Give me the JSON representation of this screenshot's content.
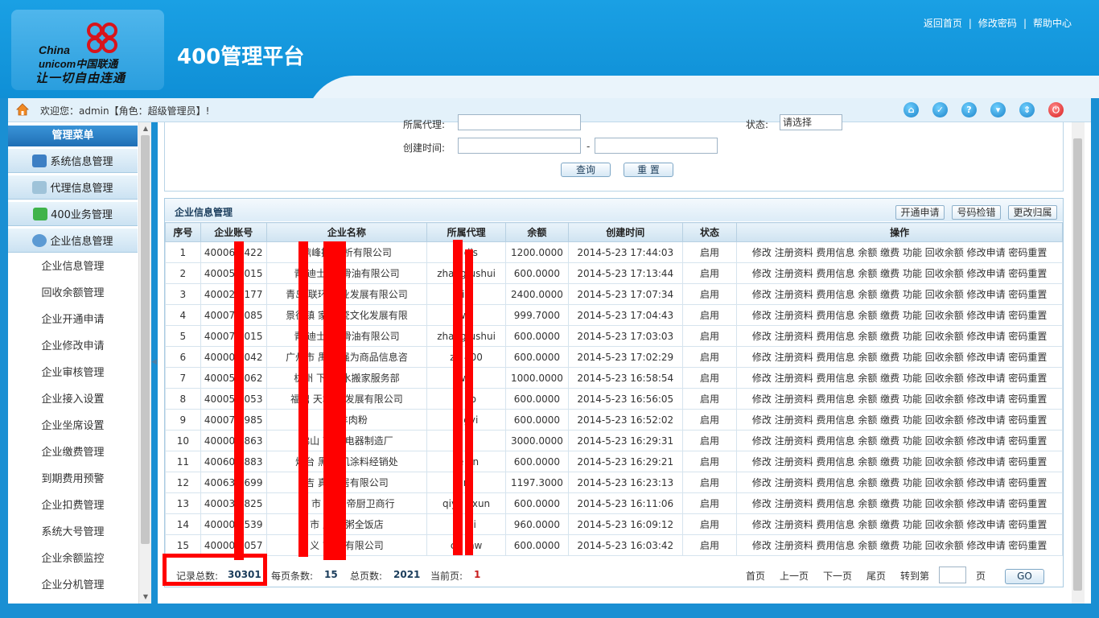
{
  "header": {
    "title": "400管理平台",
    "logo": {
      "china": "China",
      "unicom": "unicom中国联通",
      "slogan": "让一切自由连通"
    },
    "links": [
      "返回首页",
      "修改密码",
      "帮助中心"
    ]
  },
  "infobar": {
    "welcome": "欢迎您：admin【角色：超级管理员】!"
  },
  "toolbar_icons": [
    "home-icon",
    "check-icon",
    "help-icon",
    "shirt-icon",
    "updown-icon",
    "power-icon"
  ],
  "sidebar": {
    "title": "管理菜单",
    "groups": [
      "系统信息管理",
      "代理信息管理",
      "400业务管理",
      "企业信息管理"
    ],
    "items": [
      "企业信息管理",
      "回收余额管理",
      "企业开通申请",
      "企业修改申请",
      "企业审核管理",
      "企业接入设置",
      "企业坐席设置",
      "企业缴费管理",
      "到期费用预警",
      "企业扣费管理",
      "系统大号管理",
      "企业余额监控",
      "企业分机管理"
    ]
  },
  "search": {
    "agent_label": "所属代理:",
    "status_label": "状态:",
    "status_value": "请选择",
    "created_label": "创建时间:",
    "dash": "-",
    "query_btn": "查询",
    "reset_btn": "重 置"
  },
  "panel": {
    "title": "企业信息管理",
    "actions": [
      "开通申请",
      "号码检错",
      "更改归属"
    ],
    "columns": [
      "序号",
      "企业账号",
      "企业名称",
      "所属代理",
      "余额",
      "创建时间",
      "状态",
      "操作"
    ],
    "ops": "修改 注册资料 费用信息 余额 缴费 功能 回收余额 修改申请 密码重置",
    "rows": [
      {
        "no": "1",
        "account": "40006 3422",
        "name": "鼎峰技术 析有限公司",
        "agent": "h  dls",
        "balance": "1200.0000",
        "created": "2014-5-23 17:44:03",
        "status": "启用"
      },
      {
        "no": "2",
        "account": "40005 2015",
        "name": "青 迪士 康 滑油有限公司",
        "agent": "zhang  ushui",
        "balance": "600.0000",
        "created": "2014-5-23 17:13:44",
        "status": "启用"
      },
      {
        "no": "3",
        "account": "40002 3177",
        "name": "青岛 联环球 业发展有限公司",
        "agent": "   in",
        "balance": "2400.0000",
        "created": "2014-5-23 17:07:34",
        "status": "启用"
      },
      {
        "no": "4",
        "account": "40007 3085",
        "name": "景德镇 家 陶瓷文化发展有限",
        "agent": "   wl",
        "balance": "999.7000",
        "created": "2014-5-23 17:04:43",
        "status": "启用"
      },
      {
        "no": "5",
        "account": "40007 2015",
        "name": "青 迪士 康 滑油有限公司",
        "agent": "zhang  ushui",
        "balance": "600.0000",
        "created": "2014-5-23 17:03:03",
        "status": "启用"
      },
      {
        "no": "6",
        "account": "40000 2042",
        "name": "广州市 禺 励强为商品信息咨",
        "agent": "zh  400",
        "balance": "600.0000",
        "created": "2014-5-23 17:02:29",
        "status": "启用"
      },
      {
        "no": "7",
        "account": "40005 1062",
        "name": "杭州 下 区 水搬家服务部",
        "agent": "   wl",
        "balance": "1000.0000",
        "created": "2014-5-23 16:58:54",
        "status": "启用"
      },
      {
        "no": "8",
        "account": "40005 3053",
        "name": "福鼎 天地 业发展有限公司",
        "agent": "s  ao",
        "balance": "600.0000",
        "created": "2014-5-23 16:56:05",
        "status": "启用"
      },
      {
        "no": "9",
        "account": "40007 7985",
        "name": "  家 羊肉粉",
        "agent": "g  gyi",
        "balance": "600.0000",
        "created": "2014-5-23 16:52:02",
        "status": "启用"
      },
      {
        "no": "10",
        "account": "40000 3863",
        "name": "佛山 南 川电器制造厂",
        "agent": "  ",
        "balance": "3000.0000",
        "created": "2014-5-23 16:29:31",
        "status": "启用"
      },
      {
        "no": "11",
        "account": "40060 0883",
        "name": "烟台 黑 无机涂料经销处",
        "agent": "te  en",
        "balance": "600.0000",
        "created": "2014-5-23 16:29:21",
        "status": "启用"
      },
      {
        "no": "12",
        "account": "40063 4699",
        "name": "吉 真好 居有限公司",
        "agent": "  n",
        "balance": "1197.3000",
        "created": "2014-5-23 16:23:13",
        "status": "启用"
      },
      {
        "no": "13",
        "account": "40003 1825",
        "name": "南 市 成 华帝厨卫商行",
        "agent": "qiya  gxun",
        "balance": "600.0000",
        "created": "2014-5-23 16:11:06",
        "status": "启用"
      },
      {
        "no": "14",
        "account": "40000 5539",
        "name": "  市 乏 好粥全饭店",
        "agent": "li  eji",
        "balance": "960.0000",
        "created": "2014-5-23 16:09:12",
        "status": "启用"
      },
      {
        "no": "15",
        "account": "40000 3057",
        "name": "义 市 表有限公司",
        "agent": "ch  mw",
        "balance": "600.0000",
        "created": "2014-5-23 16:03:42",
        "status": "启用"
      }
    ]
  },
  "pager": {
    "total_label": "记录总数:",
    "total": "30301",
    "per_page_label": "每页条数:",
    "per_page": "15",
    "pages_label": "总页数:",
    "pages": "2021",
    "current_label": "当前页:",
    "current": "1",
    "first": "首页",
    "prev": "上一页",
    "next": "下一页",
    "last": "尾页",
    "goto": "转到第",
    "page_unit": "页",
    "go": "GO"
  }
}
